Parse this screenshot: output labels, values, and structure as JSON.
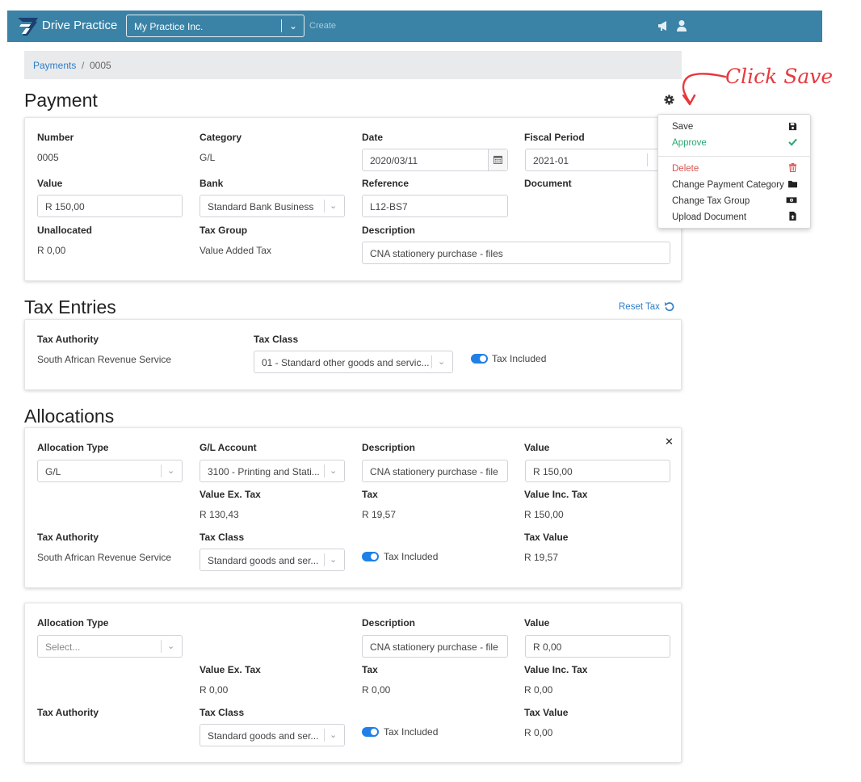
{
  "navbar": {
    "brand": "Drive Practice",
    "company": "My Practice Inc.",
    "create": "Create"
  },
  "breadcrumb": {
    "parent": "Payments",
    "separator": "/",
    "current": "0005"
  },
  "payment": {
    "title": "Payment",
    "number_label": "Number",
    "number": "0005",
    "category_label": "Category",
    "category": "G/L",
    "date_label": "Date",
    "date": "2020/03/11",
    "fiscal_label": "Fiscal Period",
    "fiscal": "2021-01",
    "value_label": "Value",
    "value": "R 150,00",
    "bank_label": "Bank",
    "bank": "Standard Bank Business",
    "reference_label": "Reference",
    "reference": "L12-BS7",
    "document_label": "Document",
    "unallocated_label": "Unallocated",
    "unallocated": "R 0,00",
    "taxgroup_label": "Tax Group",
    "taxgroup": "Value Added Tax",
    "description_label": "Description",
    "description": "CNA stationery purchase - files"
  },
  "menu": {
    "items": [
      {
        "label": "Save",
        "icon": "floppy-icon"
      },
      {
        "label": "Approve",
        "icon": "check-icon"
      },
      {
        "label": "Delete",
        "icon": "trash-icon"
      },
      {
        "label": "Change Payment Category",
        "icon": "folder-icon"
      },
      {
        "label": "Change Tax Group",
        "icon": "money-icon"
      },
      {
        "label": "Upload Document",
        "icon": "file-upload-icon"
      }
    ]
  },
  "annotation": "Click Save",
  "tax_entries": {
    "title": "Tax Entries",
    "reset": "Reset Tax",
    "authority_label": "Tax Authority",
    "authority": "South African Revenue Service",
    "class_label": "Tax Class",
    "class": "01 - Standard other goods and servic...",
    "included": "Tax Included"
  },
  "allocations": {
    "title": "Allocations",
    "rows": [
      {
        "type_label": "Allocation Type",
        "type": "G/L",
        "account_label": "G/L Account",
        "account": "3100 - Printing and Stati...",
        "desc_label": "Description",
        "desc": "CNA stationery purchase - file",
        "value_label": "Value",
        "value": "R 150,00",
        "exTax_label": "Value Ex. Tax",
        "exTax": "R 130,43",
        "tax_label": "Tax",
        "tax": "R 19,57",
        "incTax_label": "Value Inc. Tax",
        "incTax": "R 150,00",
        "authority_label": "Tax Authority",
        "authority": "South African Revenue Service",
        "class_label": "Tax Class",
        "class": "Standard goods and ser...",
        "included": "Tax Included",
        "taxValue_label": "Tax Value",
        "taxValue": "R 19,57"
      },
      {
        "type_label": "Allocation Type",
        "type_placeholder": "Select...",
        "desc_label": "Description",
        "desc": "CNA stationery purchase - file",
        "value_label": "Value",
        "value": "R 0,00",
        "exTax_label": "Value Ex. Tax",
        "exTax": "R 0,00",
        "tax_label": "Tax",
        "tax": "R 0,00",
        "incTax_label": "Value Inc. Tax",
        "incTax": "R 0,00",
        "authority_label": "Tax Authority",
        "class_label": "Tax Class",
        "class": "Standard goods and ser...",
        "included": "Tax Included",
        "taxValue_label": "Tax Value",
        "taxValue": "R 0,00"
      }
    ]
  },
  "colors": {
    "navbar": "#3a82a6",
    "link": "#2d7dc7",
    "approve": "#29a872",
    "delete": "#d9534f",
    "toggle": "#1f80e8",
    "annotation": "#e8383d"
  }
}
